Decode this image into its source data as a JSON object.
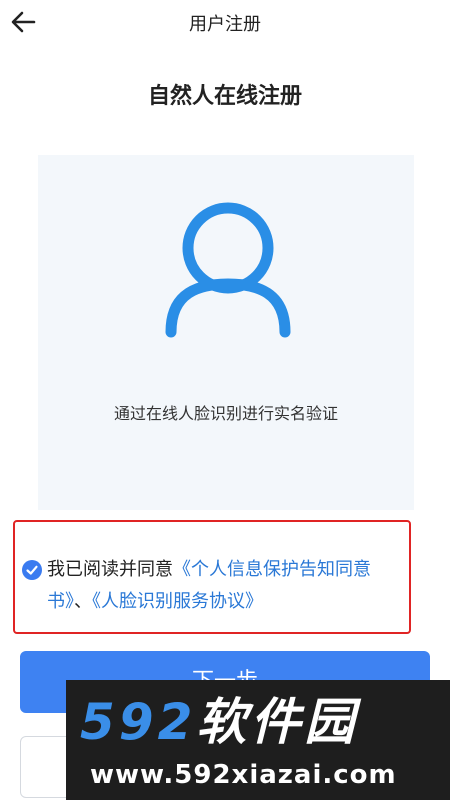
{
  "header": {
    "title": "用户注册",
    "back_icon": "arrow-left-icon"
  },
  "main": {
    "title": "自然人在线注册",
    "face_panel": {
      "avatar_icon": "user-avatar-icon",
      "caption": "通过在线人脸识别进行实名验证"
    }
  },
  "agreement": {
    "checked": true,
    "check_icon": "check-circle-icon",
    "prefix": "我已阅读并同意",
    "link1": "《个人信息保护告知同意书》",
    "separator": "、",
    "link2": "《人脸识别服务协议》"
  },
  "buttons": {
    "next_label": "下一步"
  },
  "watermark": {
    "logo_number": "592",
    "logo_text": "软件园",
    "url": "www.592xiazai.com"
  },
  "colors": {
    "primary": "#3e82f2",
    "link": "#2a78d6",
    "highlight_border": "#e02424",
    "panel_bg": "#f3f7fb"
  }
}
